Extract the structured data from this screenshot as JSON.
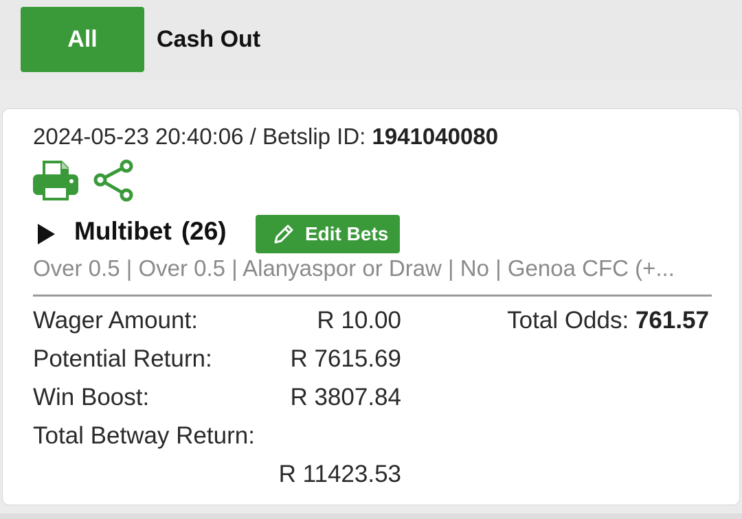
{
  "tabs": {
    "all_label": "All",
    "cashout_label": "Cash Out"
  },
  "bet": {
    "datetime": "2024-05-23 20:40:06",
    "separator": " / ",
    "betslip_prefix": "Betslip ID: ",
    "betslip_id": "1941040080",
    "type_label": "Multibet",
    "count": "(26)",
    "edit_label": "Edit Bets",
    "selections": "Over 0.5 | Over 0.5 | Alanyaspor or Draw | No | Genoa CFC (+...",
    "wager_label": "Wager Amount:",
    "wager_value": "R 10.00",
    "potential_label": "Potential Return:",
    "potential_value": "R 7615.69",
    "boost_label": "Win Boost:",
    "boost_value": "R 3807.84",
    "total_return_label": "Total Betway Return:",
    "total_return_value": "R 11423.53",
    "odds_label": "Total Odds: ",
    "odds_value": "761.57"
  },
  "icons": {
    "print": "print-icon",
    "share": "share-icon",
    "expand": "play-triangle-icon",
    "edit": "pencil-icon"
  },
  "colors": {
    "accent_green": "#3a9a3a",
    "muted_text": "#8a8a8a"
  }
}
